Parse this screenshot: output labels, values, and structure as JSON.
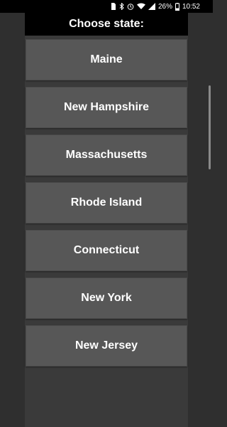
{
  "status_bar": {
    "battery_text": "26%",
    "time": "10:52",
    "icons": [
      "sim-icon",
      "bluetooth-icon",
      "alarm-icon",
      "wifi-icon",
      "signal-icon",
      "battery-icon"
    ]
  },
  "title": "Choose state:",
  "states": [
    "Maine",
    "New Hampshire",
    "Massachusetts",
    "Rhode Island",
    "Connecticut",
    "New York",
    "New Jersey"
  ],
  "colors": {
    "background": "#2f2f2f",
    "title_bar": "#000000",
    "button": "#575757",
    "text": "#ffffff"
  }
}
